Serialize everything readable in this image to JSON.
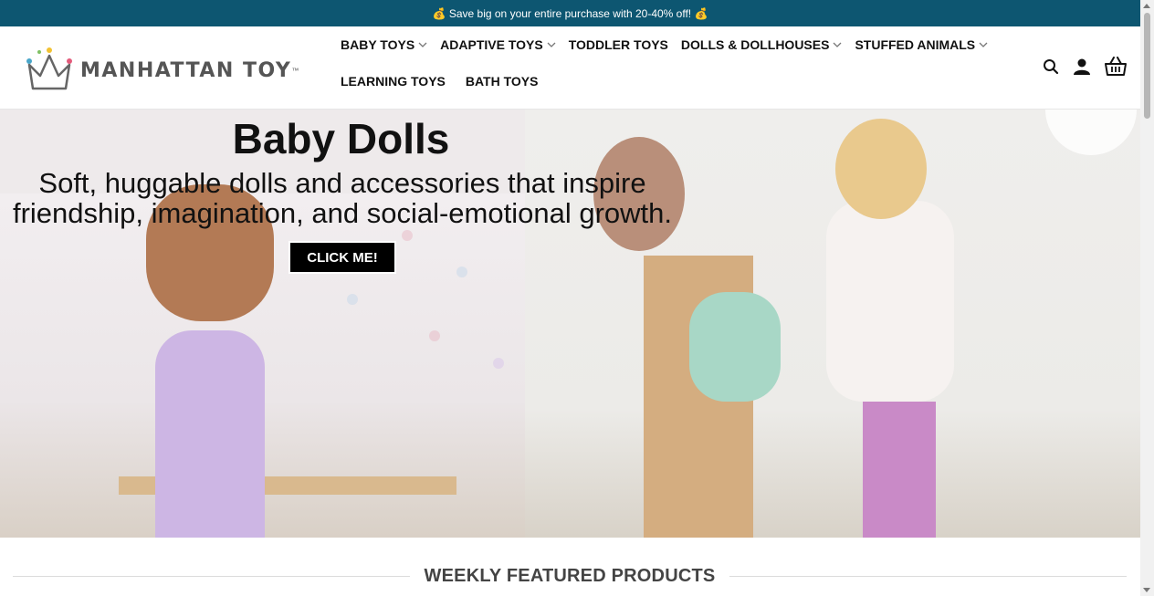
{
  "promo": {
    "text": "💰 Save big on your entire purchase with 20-40% off! 💰"
  },
  "logo": {
    "text": "MANHATTAN TOY",
    "tm": "™"
  },
  "nav": {
    "items": [
      {
        "label": "BABY TOYS",
        "dropdown": true
      },
      {
        "label": "ADAPTIVE TOYS",
        "dropdown": true
      },
      {
        "label": "TODDLER TOYS",
        "dropdown": false
      },
      {
        "label": "DOLLS & DOLLHOUSES",
        "dropdown": true
      },
      {
        "label": "STUFFED ANIMALS",
        "dropdown": true
      },
      {
        "label": "LEARNING TOYS",
        "dropdown": false
      },
      {
        "label": "BATH TOYS",
        "dropdown": false
      }
    ]
  },
  "header_icons": [
    "search-icon",
    "account-icon",
    "basket-icon"
  ],
  "hero": {
    "title": "Baby Dolls",
    "subtitle_line1": "Soft, huggable dolls and accessories that inspire",
    "subtitle_line2": "friendship, imagination, and social-emotional growth.",
    "cta": "CLICK ME!"
  },
  "section": {
    "title": "WEEKLY FEATURED PRODUCTS"
  },
  "colors": {
    "promo_bg": "#0d5671",
    "cta_bg": "#000000",
    "text": "#111111"
  }
}
